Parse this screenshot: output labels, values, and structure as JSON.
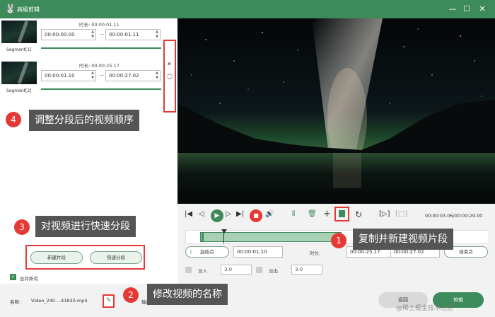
{
  "window": {
    "title": "高级剪辑",
    "logo": "🐰"
  },
  "segments": [
    {
      "label": "Segment[1]",
      "duration": "时长: 00:00:01.11",
      "start": "00:00:00.00",
      "end": "00:00:01.11"
    },
    {
      "label": "Segment[2]",
      "duration": "时长: 00:00:25.17",
      "start": "00:00:01.10",
      "end": "00:00:27.02"
    }
  ],
  "annotations": {
    "a1": {
      "num": "1",
      "text": "复制并新建视频片段"
    },
    "a2": {
      "num": "2",
      "text": "修改视频的名称"
    },
    "a3": {
      "num": "3",
      "text": "对视频进行快速分段"
    },
    "a4": {
      "num": "4",
      "text": "调整分段后的视频顺序"
    }
  },
  "split": {
    "new_segment": "新建片段",
    "fast_split": "快速分段"
  },
  "merge_all": "合并所有",
  "player": {
    "timecode": "00:00:03.06/00:00:29.00"
  },
  "trim": {
    "start_label": "起始点",
    "start_value": "00:00:01.10",
    "duration_label": "时长:",
    "duration_value": "00:00:25.17",
    "end_value": "00:00:27.02",
    "end_label": "结束点"
  },
  "fade": {
    "in_label": "淡入",
    "in_value": "3.0",
    "out_label": "淡出",
    "out_value": "3.0"
  },
  "footer": {
    "name_label": "名称:",
    "name_value": "Video_240....41830.mp4",
    "output_label": "输出",
    "back": "返回",
    "cut": "剪辑",
    "watermark": "@稀土掘金技术社区"
  },
  "colors": {
    "accent": "#3d8a5a",
    "highlight": "#e53935"
  }
}
